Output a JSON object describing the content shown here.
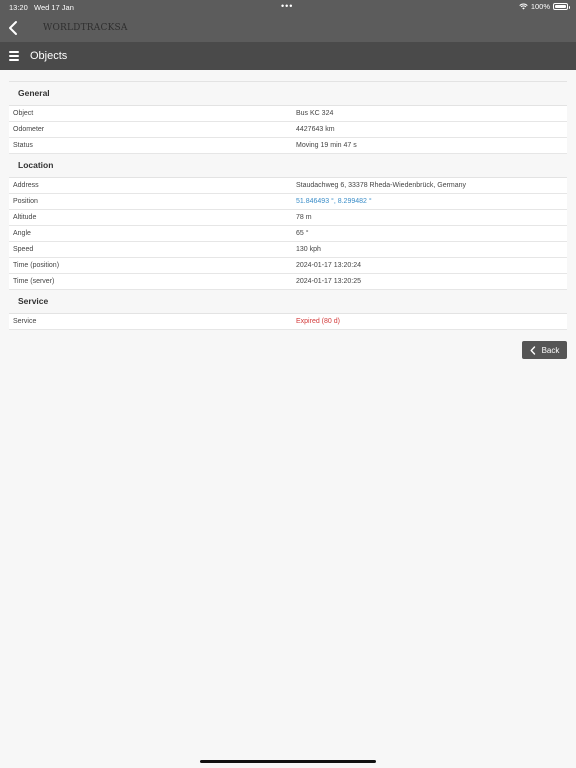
{
  "status_bar": {
    "time": "13:20",
    "date": "Wed 17 Jan",
    "dots": "•••",
    "battery": "100%"
  },
  "header": {
    "brand": "WORLDTRACKSA",
    "title": "Objects"
  },
  "sections": [
    {
      "title": "General",
      "rows": [
        {
          "label": "Object",
          "value": "Bus KC 324"
        },
        {
          "label": "Odometer",
          "value": "4427643 km"
        },
        {
          "label": "Status",
          "value": "Moving 19 min 47 s"
        }
      ]
    },
    {
      "title": "Location",
      "rows": [
        {
          "label": "Address",
          "value": "Staudachweg 6, 33378 Rheda-Wiedenbrück, Germany"
        },
        {
          "label": "Position",
          "value": "51.846493 °, 8.299482 °"
        },
        {
          "label": "Altitude",
          "value": "78 m"
        },
        {
          "label": "Angle",
          "value": "65 °"
        },
        {
          "label": "Speed",
          "value": "130 kph"
        },
        {
          "label": "Time (position)",
          "value": "2024-01-17 13:20:24"
        },
        {
          "label": "Time (server)",
          "value": "2024-01-17 13:20:25"
        }
      ]
    },
    {
      "title": "Service",
      "rows": [
        {
          "label": "Service",
          "value": "Expired (80 d)"
        }
      ]
    }
  ],
  "back_button": {
    "label": "Back"
  },
  "colors": {
    "link": "#3a8dc8",
    "warning": "#d33b3b",
    "header_bg": "#4a4a4a"
  }
}
